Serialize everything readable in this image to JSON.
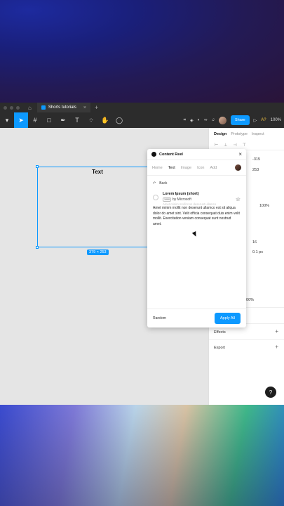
{
  "window": {
    "tab_title": "Shorts tutorials",
    "close_glyph": "×",
    "new_tab_glyph": "+"
  },
  "toolbar": {
    "share_label": "Share",
    "ai_label": "A?",
    "zoom": "100%"
  },
  "canvas": {
    "frame_text": "Text",
    "frame_dimensions": "379 × 253"
  },
  "right_panel": {
    "tabs": [
      "Design",
      "Prototype",
      "Inspect"
    ],
    "y_value": "-315",
    "h_value": "253",
    "opacity": "100%",
    "font_size": "16",
    "line_height": "0.1 px",
    "layer_opacity": "100%",
    "effects_label": "Effects",
    "export_label": "Export",
    "help_glyph": "?"
  },
  "plugin": {
    "title": "Content Reel",
    "nav": [
      "Home",
      "Text",
      "Image",
      "Icon",
      "Add"
    ],
    "back_label": "Back",
    "item": {
      "name": "Lorem Ipsum (short)",
      "chip": "1000",
      "author": "by Microsoft",
      "preview": "Amet minim mollit non deserunt ullamco"
    },
    "body_text": "Amet minim mollit non deserunt ullamco est sit aliqua dolor do amet sint. Velit officia consequat duis enim velit mollit. Exercitation veniam consequat sunt nostrud amet.",
    "random_label": "Random",
    "apply_label": "Apply All"
  },
  "colors": {
    "accent": "#0d99ff",
    "toolbar_bg": "#2c2c2c",
    "canvas_bg": "#e5e5e5"
  }
}
